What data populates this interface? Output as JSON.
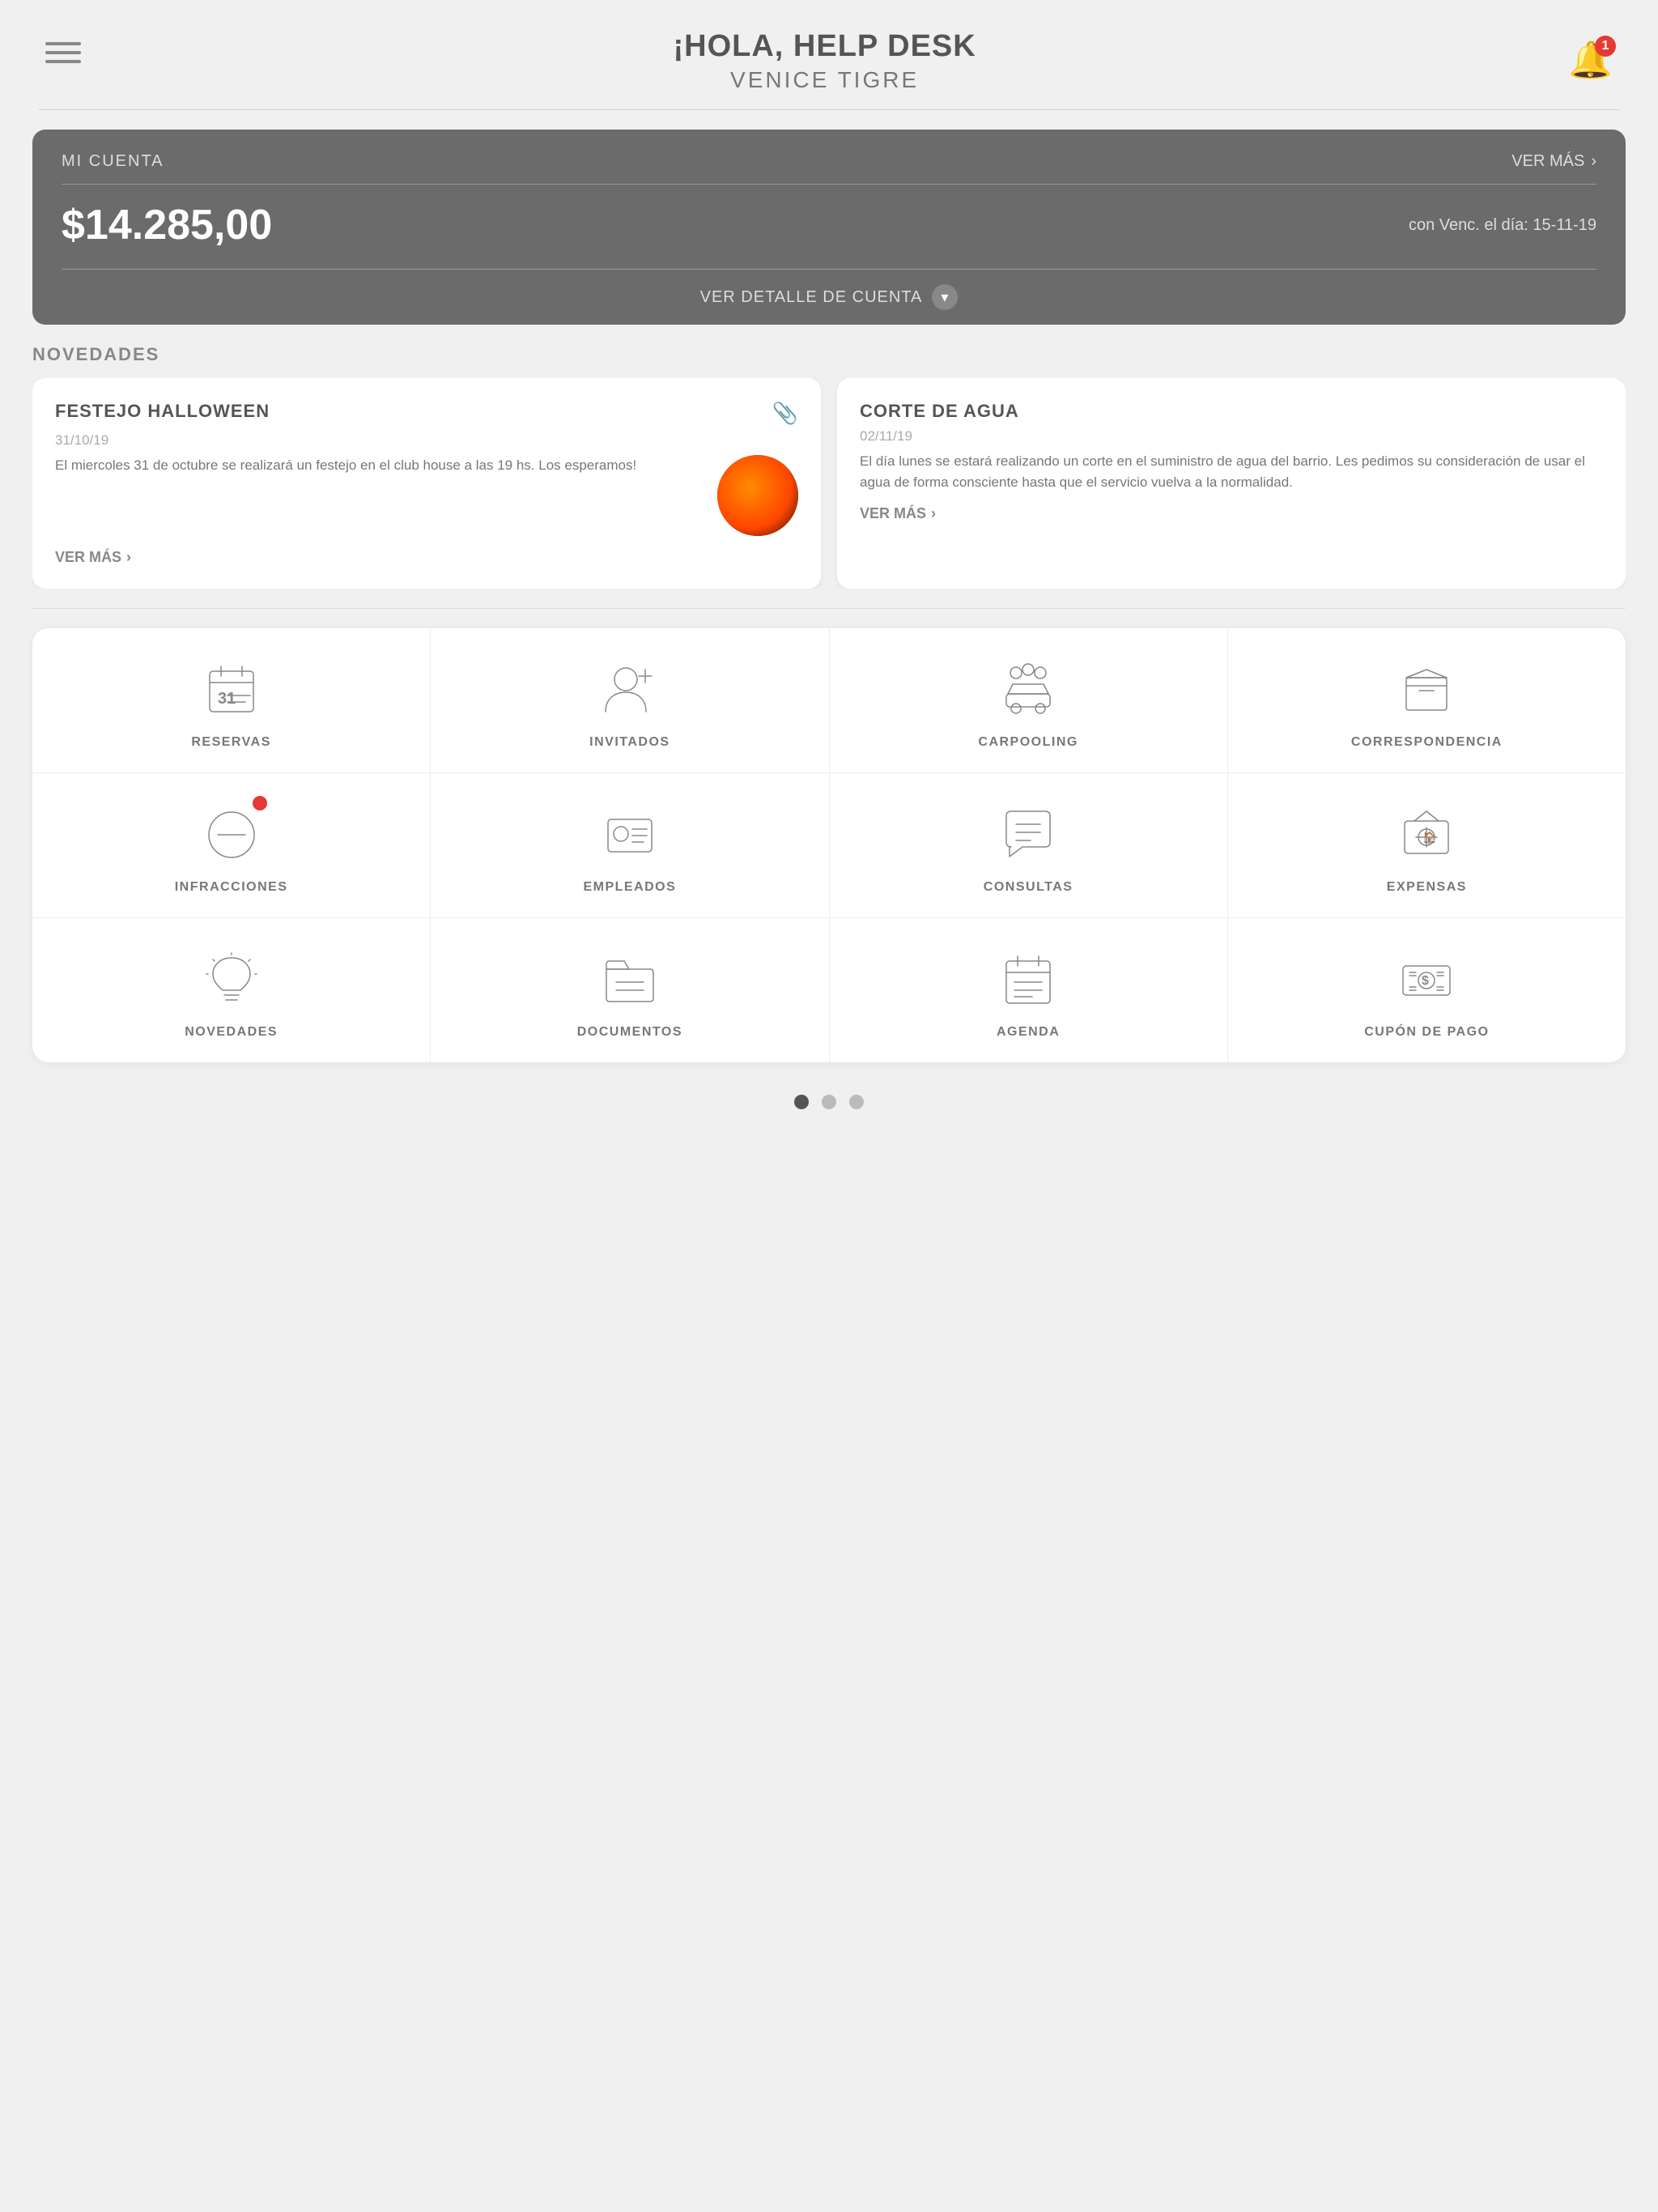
{
  "header": {
    "greeting": "¡HOLA, HELP DESK",
    "subtitle": "VENICE TIGRE",
    "notification_count": "1"
  },
  "account": {
    "label": "MI CUENTA",
    "ver_mas": "VER MÁS",
    "amount": "$14.285,00",
    "venc_label": "con Venc. el día: 15-11-19",
    "detail_btn": "VER DETALLE DE CUENTA"
  },
  "novedades_label": "NOVEDADES",
  "news": [
    {
      "title": "FESTEJO HALLOWEEN",
      "date": "31/10/19",
      "text": "El miercoles 31 de octubre se realizará un festejo en el club house a las 19 hs. Los esperamos!",
      "ver_mas": "VER MÁS",
      "has_image": true
    },
    {
      "title": "CORTE DE AGUA",
      "date": "02/11/19",
      "text": "El día lunes se estará realizando un corte en el suministro de agua del barrio. Les pedimos su consideración de usar el agua de forma consciente hasta que el servicio vuelva a la normalidad.",
      "ver_mas": "VER MÁS",
      "has_image": false
    }
  ],
  "grid": {
    "rows": [
      [
        {
          "id": "reservas",
          "label": "RESERVAS",
          "icon": "calendar",
          "badge": false
        },
        {
          "id": "invitados",
          "label": "INVITADOS",
          "icon": "person-add",
          "badge": false
        },
        {
          "id": "carpooling",
          "label": "CARPOOLING",
          "icon": "car-people",
          "badge": false
        },
        {
          "id": "correspondencia",
          "label": "CORRESPONDENCIA",
          "icon": "box",
          "badge": false
        }
      ],
      [
        {
          "id": "infracciones",
          "label": "INFRACCIONES",
          "icon": "no-circle",
          "badge": true
        },
        {
          "id": "empleados",
          "label": "EMPLEADOS",
          "icon": "id-card",
          "badge": false
        },
        {
          "id": "consultas",
          "label": "CONSULTAS",
          "icon": "chat",
          "badge": false
        },
        {
          "id": "expensas",
          "label": "EXPENSAS",
          "icon": "money-house",
          "badge": false
        }
      ],
      [
        {
          "id": "novedades",
          "label": "NOVEDADES",
          "icon": "bulb",
          "badge": false
        },
        {
          "id": "documentos",
          "label": "DOCUMENTOS",
          "icon": "folder",
          "badge": false
        },
        {
          "id": "agenda",
          "label": "AGENDA",
          "icon": "calendar2",
          "badge": false
        },
        {
          "id": "cupon-de-pago",
          "label": "CUPÓN DE PAGO",
          "icon": "dollar-bill",
          "badge": false
        }
      ]
    ]
  },
  "pagination": {
    "total": 3,
    "active": 0
  }
}
